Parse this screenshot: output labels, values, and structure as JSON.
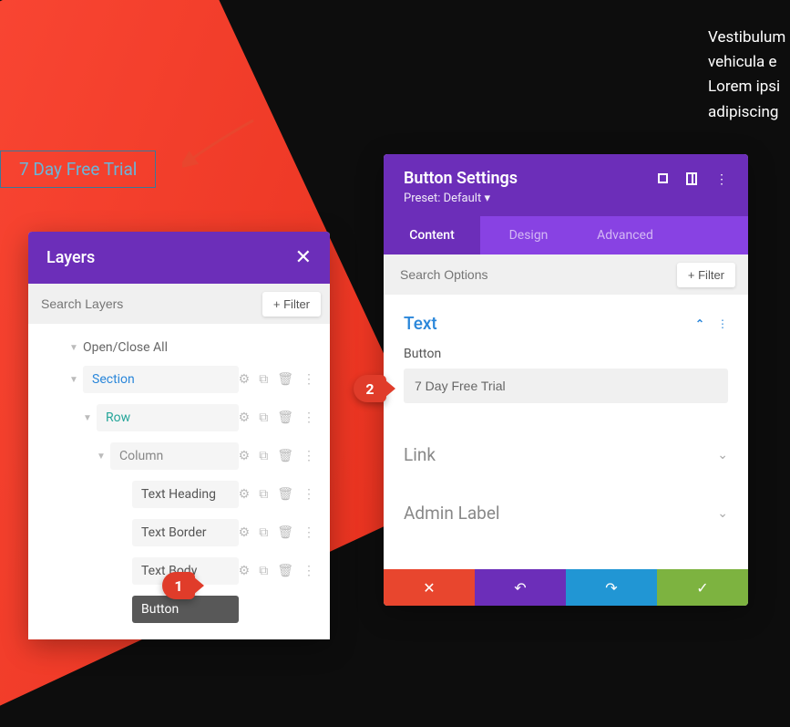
{
  "preview": {
    "button_text": "7 Day Free Trial"
  },
  "lorem": {
    "line1": "Vestibulum",
    "line2": "vehicula e",
    "line3": "Lorem ipsi",
    "line4": "adipiscing"
  },
  "layers": {
    "title": "Layers",
    "search_placeholder": "Search Layers",
    "filter_label": "Filter",
    "open_all": "Open/Close All",
    "tree": {
      "section": "Section",
      "row": "Row",
      "column": "Column",
      "modules": [
        "Text Heading",
        "Text Border",
        "Text Body",
        "Button"
      ]
    }
  },
  "settings": {
    "title": "Button Settings",
    "preset": "Preset: Default",
    "tabs": {
      "content": "Content",
      "design": "Design",
      "advanced": "Advanced"
    },
    "search_placeholder": "Search Options",
    "filter_label": "Filter",
    "sections": {
      "text": {
        "title": "Text",
        "button_label": "Button",
        "button_value": "7 Day Free Trial"
      },
      "link": "Link",
      "admin_label": "Admin Label"
    }
  },
  "callouts": {
    "one": "1",
    "two": "2"
  }
}
